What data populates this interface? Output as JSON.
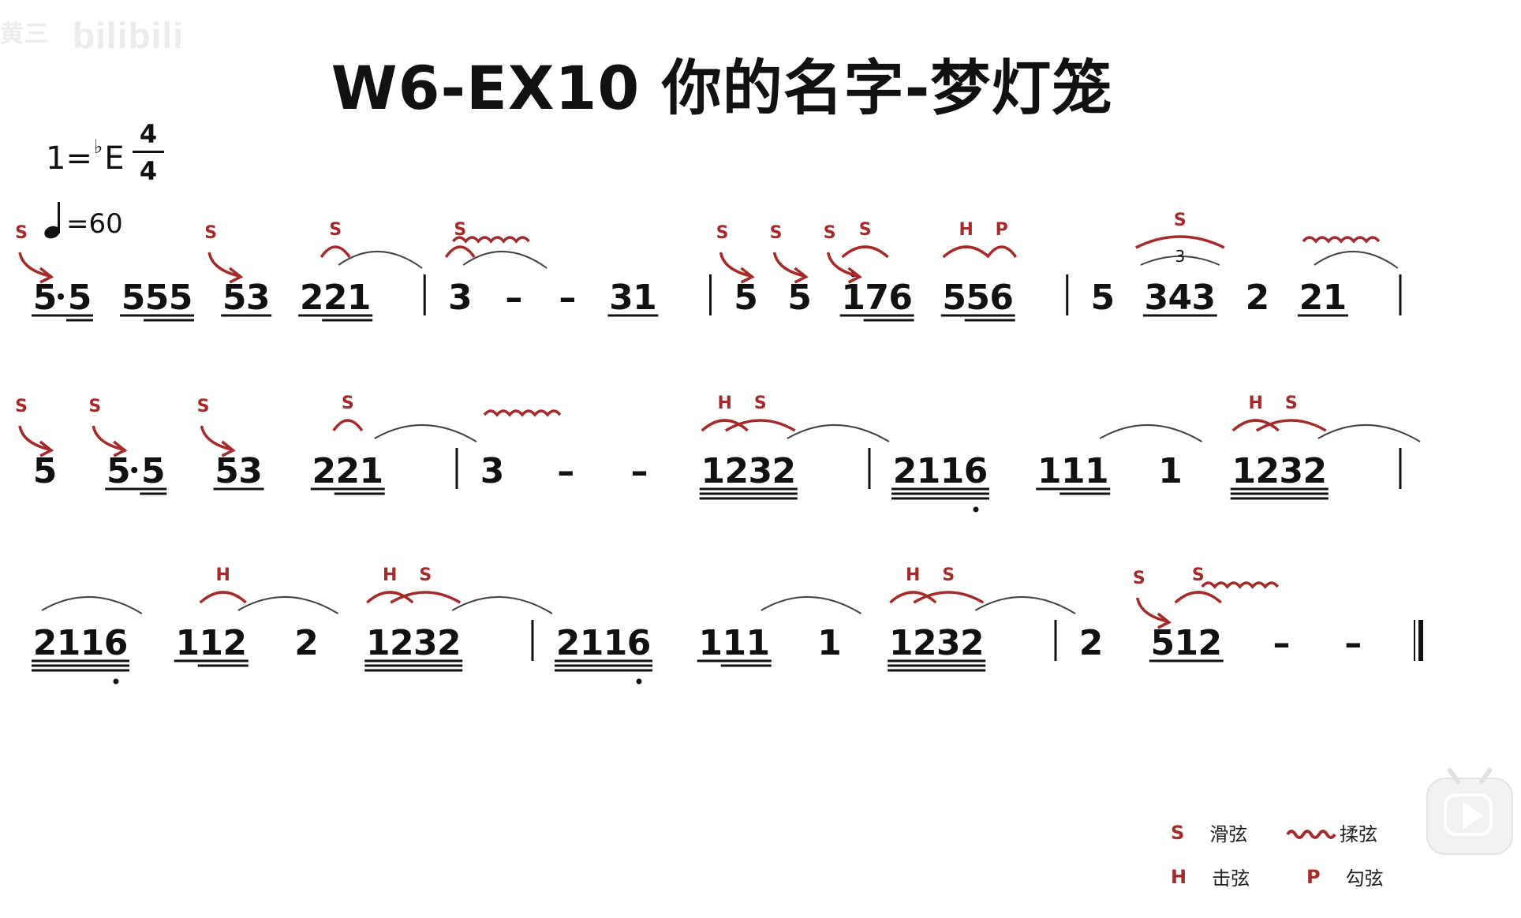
{
  "watermark": "bilibili",
  "title": "W6-EX10 你的名字-梦灯笼",
  "key": {
    "prefix": "1=",
    "flat": "♭",
    "note": "E"
  },
  "time_signature": {
    "top": "4",
    "bottom": "4"
  },
  "tempo": {
    "text": "=60"
  },
  "rows": [
    {
      "groups": [
        {
          "notes": [
            {
              "d": "5",
              "u": 1,
              "dot": true
            },
            {
              "d": "5",
              "u": 2
            }
          ],
          "marks": [
            {
              "t": "SA",
              "a": 0
            }
          ]
        },
        {
          "notes": [
            {
              "d": "5",
              "u": 1
            },
            {
              "d": "5",
              "u": 2
            },
            {
              "d": "5",
              "u": 2
            }
          ]
        },
        {
          "notes": [
            {
              "d": "5",
              "u": 1
            },
            {
              "d": "3",
              "u": 1
            }
          ],
          "marks": [
            {
              "t": "SA",
              "a": 0
            }
          ]
        },
        {
          "notes": [
            {
              "d": "2",
              "u": 1
            },
            {
              "d": "2",
              "u": 2
            },
            {
              "d": "1",
              "u": 2
            }
          ],
          "marks": [
            {
              "t": "S",
              "a": 1
            },
            {
              "t": "SL",
              "a": 1,
              "b": 2
            }
          ]
        },
        {
          "bar": true
        },
        {
          "notes": [
            {
              "d": "3"
            }
          ],
          "marks": [
            {
              "t": "S",
              "a": 0
            },
            {
              "t": "SL",
              "a": 0,
              "b": 0
            }
          ]
        },
        {
          "notes": [
            {
              "d": "–"
            }
          ]
        },
        {
          "notes": [
            {
              "d": "–"
            }
          ],
          "marks": [
            {
              "t": "R",
              "a": -1
            }
          ]
        },
        {
          "notes": [
            {
              "d": "3",
              "u": 1
            },
            {
              "d": "1",
              "u": 1
            }
          ]
        },
        {
          "bar": true
        },
        {
          "notes": [
            {
              "d": "5"
            }
          ],
          "marks": [
            {
              "t": "SA",
              "a": 0
            }
          ]
        },
        {
          "notes": [
            {
              "d": "5"
            }
          ],
          "marks": [
            {
              "t": "SA",
              "a": 0
            }
          ]
        },
        {
          "notes": [
            {
              "d": "1",
              "u": 1,
              "hi": true
            },
            {
              "d": "7",
              "u": 2
            },
            {
              "d": "6",
              "u": 2
            }
          ],
          "marks": [
            {
              "t": "SA",
              "a": 0
            },
            {
              "t": "S",
              "a": 0,
              "b": 1
            }
          ]
        },
        {
          "notes": [
            {
              "d": "5",
              "u": 1
            },
            {
              "d": "5",
              "u": 2
            },
            {
              "d": "6",
              "u": 2
            }
          ],
          "marks": [
            {
              "t": "H",
              "a": 0,
              "b": 1
            },
            {
              "t": "P",
              "a": 2,
              "b": 2
            }
          ]
        },
        {
          "bar": true
        },
        {
          "notes": [
            {
              "d": "5"
            }
          ]
        },
        {
          "notes": [
            {
              "d": "3",
              "u": 1
            },
            {
              "d": "4",
              "u": 1
            },
            {
              "d": "3",
              "u": 1
            }
          ],
          "marks": [
            {
              "t": "S3",
              "a": 0,
              "b": 2
            }
          ]
        },
        {
          "notes": [
            {
              "d": "2"
            }
          ]
        },
        {
          "notes": [
            {
              "d": "2",
              "u": 1
            },
            {
              "d": "1",
              "u": 1
            }
          ],
          "marks": [
            {
              "t": "R",
              "a": 0
            },
            {
              "t": "SL",
              "a": 0,
              "b": 0
            }
          ]
        },
        {
          "bar": true
        }
      ]
    },
    {
      "groups": [
        {
          "notes": [
            {
              "d": "5"
            }
          ],
          "marks": [
            {
              "t": "SA",
              "a": 0
            }
          ]
        },
        {
          "notes": [
            {
              "d": "5",
              "u": 1,
              "dot": true
            },
            {
              "d": "5",
              "u": 2
            }
          ],
          "marks": [
            {
              "t": "SA",
              "a": 0
            }
          ]
        },
        {
          "notes": [
            {
              "d": "5",
              "u": 1
            },
            {
              "d": "3",
              "u": 1
            }
          ],
          "marks": [
            {
              "t": "SA",
              "a": 0
            }
          ]
        },
        {
          "notes": [
            {
              "d": "2",
              "u": 1
            },
            {
              "d": "2",
              "u": 2
            },
            {
              "d": "1",
              "u": 2
            }
          ],
          "marks": [
            {
              "t": "S",
              "a": 1
            },
            {
              "t": "SL",
              "a": 2,
              "b": 2
            }
          ]
        },
        {
          "bar": true
        },
        {
          "notes": [
            {
              "d": "3"
            }
          ],
          "marks": [
            {
              "t": "R",
              "a": 0
            }
          ]
        },
        {
          "notes": [
            {
              "d": "–"
            }
          ]
        },
        {
          "notes": [
            {
              "d": "–"
            }
          ]
        },
        {
          "notes": [
            {
              "d": "1",
              "u": 3
            },
            {
              "d": "2",
              "u": 3
            },
            {
              "d": "3",
              "u": 3
            },
            {
              "d": "2",
              "u": 3
            }
          ],
          "marks": [
            {
              "t": "H",
              "a": 0,
              "b": 1
            },
            {
              "t": "S",
              "a": 1,
              "b": 3
            },
            {
              "t": "SL",
              "a": 3,
              "b": 3
            }
          ]
        },
        {
          "bar": true
        },
        {
          "notes": [
            {
              "d": "2",
              "u": 3
            },
            {
              "d": "1",
              "u": 3
            },
            {
              "d": "1",
              "u": 3
            },
            {
              "d": "6",
              "u": 3,
              "lo": true
            }
          ]
        },
        {
          "notes": [
            {
              "d": "1",
              "u": 1
            },
            {
              "d": "1",
              "u": 2
            },
            {
              "d": "1",
              "u": 2
            }
          ],
          "marks": [
            {
              "t": "SL",
              "a": 2,
              "b": 2
            }
          ]
        },
        {
          "notes": [
            {
              "d": "1"
            }
          ]
        },
        {
          "notes": [
            {
              "d": "1",
              "u": 3
            },
            {
              "d": "2",
              "u": 3
            },
            {
              "d": "3",
              "u": 3
            },
            {
              "d": "2",
              "u": 3
            }
          ],
          "marks": [
            {
              "t": "H",
              "a": 0,
              "b": 1
            },
            {
              "t": "S",
              "a": 1,
              "b": 3
            },
            {
              "t": "SL",
              "a": 3,
              "b": 3
            }
          ]
        },
        {
          "bar": true
        }
      ]
    },
    {
      "groups": [
        {
          "notes": [
            {
              "d": "2",
              "u": 3
            },
            {
              "d": "1",
              "u": 3
            },
            {
              "d": "1",
              "u": 3
            },
            {
              "d": "6",
              "u": 3,
              "lo": true
            }
          ],
          "marks": [
            {
              "t": "SL",
              "a": -1,
              "b": 0
            }
          ]
        },
        {
          "notes": [
            {
              "d": "1",
              "u": 1
            },
            {
              "d": "1",
              "u": 2
            },
            {
              "d": "2",
              "u": 2
            }
          ],
          "marks": [
            {
              "t": "H",
              "a": 1,
              "b": 2
            },
            {
              "t": "SL",
              "a": 2,
              "b": 2
            }
          ]
        },
        {
          "notes": [
            {
              "d": "2"
            }
          ]
        },
        {
          "notes": [
            {
              "d": "1",
              "u": 3
            },
            {
              "d": "2",
              "u": 3
            },
            {
              "d": "3",
              "u": 3
            },
            {
              "d": "2",
              "u": 3
            }
          ],
          "marks": [
            {
              "t": "H",
              "a": 0,
              "b": 1
            },
            {
              "t": "S",
              "a": 1,
              "b": 3
            },
            {
              "t": "SL",
              "a": 3,
              "b": 3
            }
          ]
        },
        {
          "bar": true
        },
        {
          "notes": [
            {
              "d": "2",
              "u": 3
            },
            {
              "d": "1",
              "u": 3
            },
            {
              "d": "1",
              "u": 3
            },
            {
              "d": "6",
              "u": 3,
              "lo": true
            }
          ]
        },
        {
          "notes": [
            {
              "d": "1",
              "u": 1
            },
            {
              "d": "1",
              "u": 2
            },
            {
              "d": "1",
              "u": 2
            }
          ],
          "marks": [
            {
              "t": "SL",
              "a": 2,
              "b": 2
            }
          ]
        },
        {
          "notes": [
            {
              "d": "1"
            }
          ]
        },
        {
          "notes": [
            {
              "d": "1",
              "u": 3
            },
            {
              "d": "2",
              "u": 3
            },
            {
              "d": "3",
              "u": 3
            },
            {
              "d": "2",
              "u": 3
            }
          ],
          "marks": [
            {
              "t": "H",
              "a": 0,
              "b": 1
            },
            {
              "t": "S",
              "a": 1,
              "b": 3
            },
            {
              "t": "SL",
              "a": 3,
              "b": 3
            }
          ]
        },
        {
          "bar": true
        },
        {
          "notes": [
            {
              "d": "2"
            }
          ]
        },
        {
          "notes": [
            {
              "d": "5",
              "u": 1
            },
            {
              "d": "1",
              "u": 1
            },
            {
              "d": "2",
              "u": 1
            }
          ],
          "marks": [
            {
              "t": "SA",
              "a": 0
            },
            {
              "t": "S",
              "a": 1,
              "b": 2
            },
            {
              "t": "R",
              "a": 2
            }
          ]
        },
        {
          "notes": [
            {
              "d": "–"
            }
          ]
        },
        {
          "notes": [
            {
              "d": "–"
            }
          ]
        },
        {
          "end": true
        }
      ]
    }
  ],
  "legend": {
    "slide_symbol": "S",
    "slide_label": "滑弦",
    "vibrato_label": "揉弦",
    "hammer_symbol": "H",
    "hammer_label": "击弦",
    "pull_symbol": "P",
    "pull_label": "勾弦"
  },
  "colors": {
    "ink": "#111111",
    "technique": "#a52a2a",
    "tie": "#444444"
  },
  "icons": {
    "play": "play-icon",
    "tempo": "quarter-note-icon",
    "vibrato": "wavy-line-icon"
  }
}
